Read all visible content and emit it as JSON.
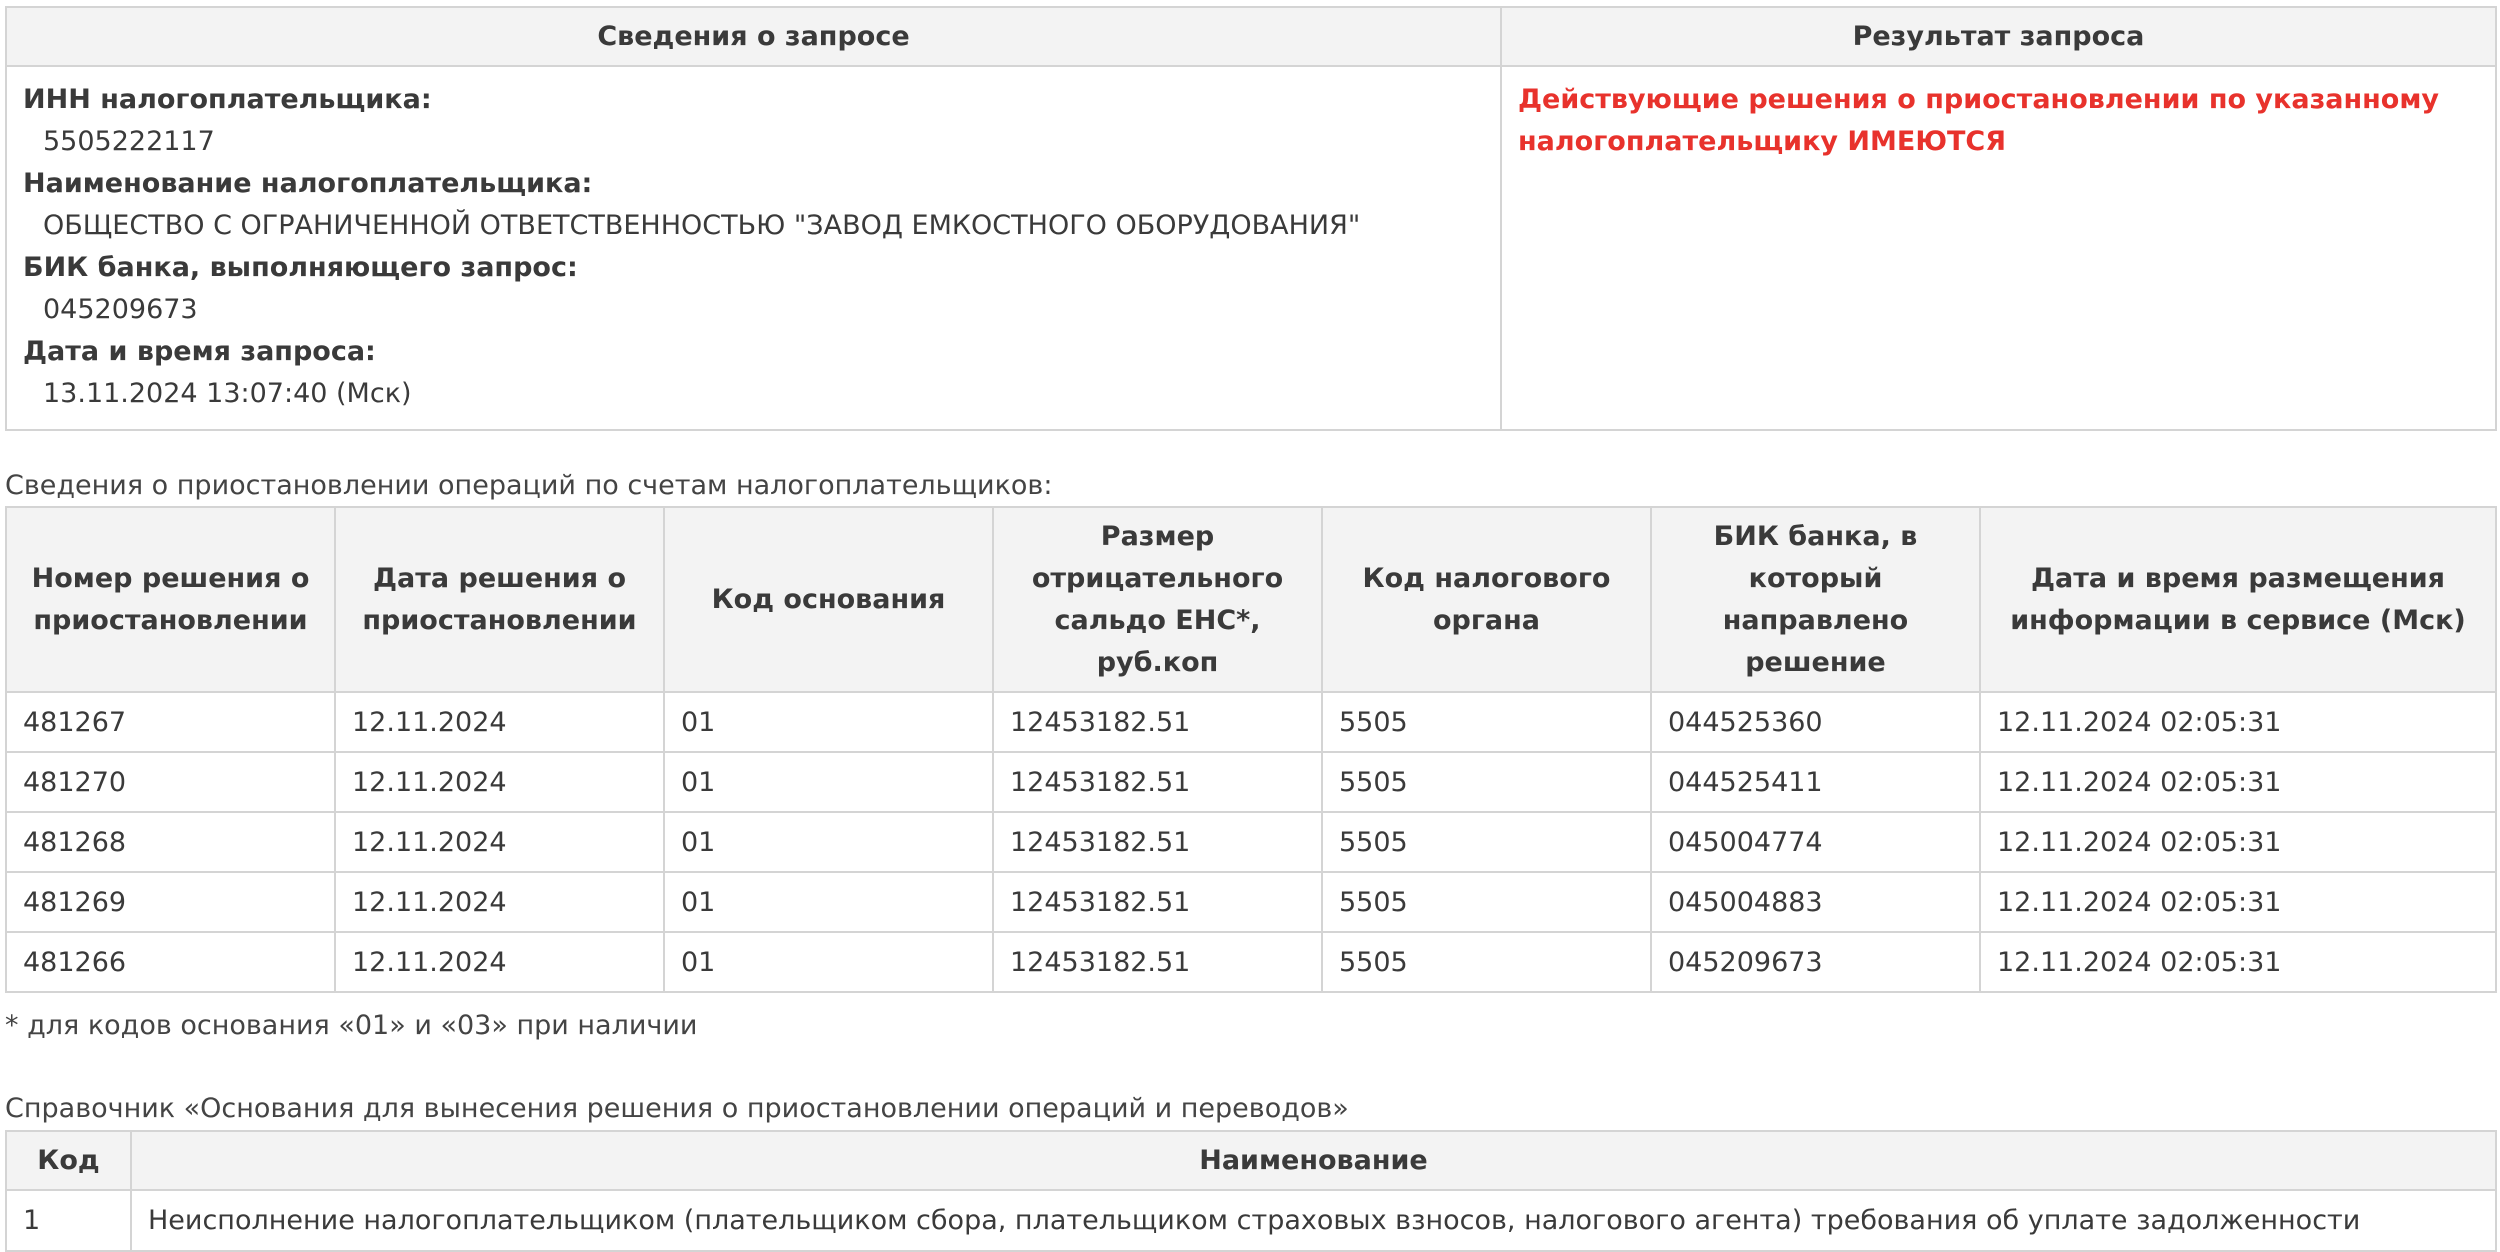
{
  "request_info": {
    "header_left": "Сведения о запросе",
    "header_right": "Результат запроса",
    "fields": [
      {
        "label": "ИНН налогоплательщика:",
        "value": "5505222117"
      },
      {
        "label": "Наименование налогоплательщика:",
        "value": "ОБЩЕСТВО С ОГРАНИЧЕННОЙ ОТВЕТСТВЕННОСТЬЮ \"ЗАВОД ЕМКОСТНОГО ОБОРУДОВАНИЯ\""
      },
      {
        "label": "БИК банка, выполняющего запрос:",
        "value": "045209673"
      },
      {
        "label": "Дата и время запроса:",
        "value": "13.11.2024 13:07:40 (Мск)"
      }
    ],
    "result_text": "Действующие решения о приостановлении по указанному налогоплательщику ИМЕЮТСЯ",
    "result_color": "#e8322c"
  },
  "suspensions": {
    "caption": "Сведения о приостановлении операций по счетам налогоплательщиков:",
    "columns": [
      "Номер решения о приостановлении",
      "Дата решения о приостановлении",
      "Код основания",
      "Размер отрицательного сальдо ЕНС*, руб.коп",
      "Код налогового органа",
      "БИК банка, в который направлено решение",
      "Дата и время размещения информации в сервисе (Мск)"
    ],
    "rows": [
      [
        "481267",
        "12.11.2024",
        "01",
        "12453182.51",
        "5505",
        "044525360",
        "12.11.2024 02:05:31"
      ],
      [
        "481270",
        "12.11.2024",
        "01",
        "12453182.51",
        "5505",
        "044525411",
        "12.11.2024 02:05:31"
      ],
      [
        "481268",
        "12.11.2024",
        "01",
        "12453182.51",
        "5505",
        "045004774",
        "12.11.2024 02:05:31"
      ],
      [
        "481269",
        "12.11.2024",
        "01",
        "12453182.51",
        "5505",
        "045004883",
        "12.11.2024 02:05:31"
      ],
      [
        "481266",
        "12.11.2024",
        "01",
        "12453182.51",
        "5505",
        "045209673",
        "12.11.2024 02:05:31"
      ]
    ],
    "footnote": "* для кодов основания «01» и «03» при наличии"
  },
  "reference": {
    "caption": "Справочник «Основания для вынесения решения о приостановлении операций и переводов»",
    "columns": [
      "Код",
      "Наименование"
    ],
    "rows": [
      [
        "1",
        "Неисполнение налогоплательщиком (плательщиком сбора, плательщиком страховых взносов, налогового агента) требования об уплате задолженности"
      ]
    ]
  }
}
